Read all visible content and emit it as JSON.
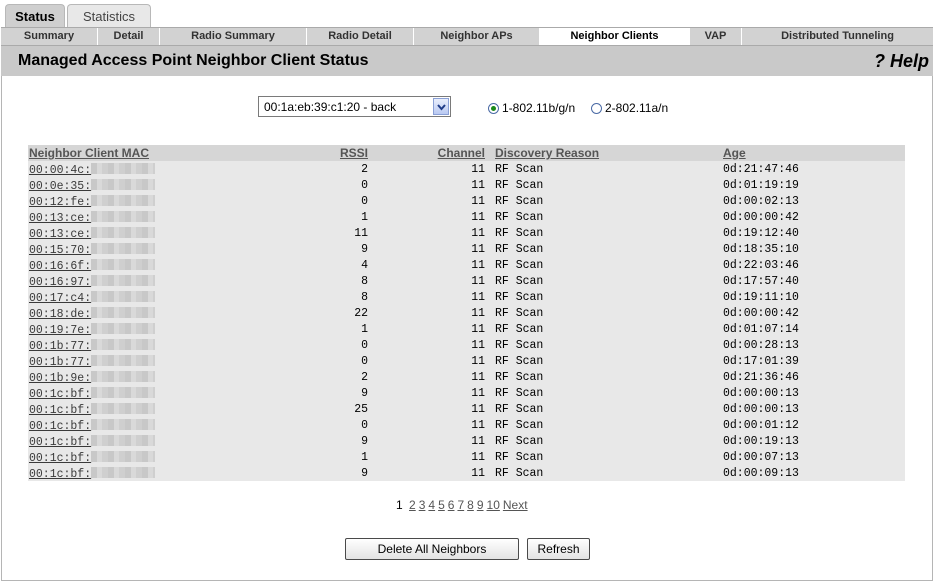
{
  "top_tabs": [
    {
      "label": "Status",
      "active": true
    },
    {
      "label": "Statistics",
      "active": false
    }
  ],
  "sub_tabs": [
    {
      "label": "Summary"
    },
    {
      "label": "Detail"
    },
    {
      "label": "Radio Summary"
    },
    {
      "label": "Radio Detail"
    },
    {
      "label": "Neighbor APs"
    },
    {
      "label": "Neighbor Clients",
      "active": true
    },
    {
      "label": "VAP"
    },
    {
      "label": "Distributed Tunneling"
    }
  ],
  "page": {
    "title": "Managed Access Point Neighbor Client Status",
    "help": "? Help"
  },
  "ap_select": {
    "value": "00:1a:eb:39:c1:20 - back"
  },
  "radios": [
    {
      "label": "1-802.11b/g/n",
      "checked": true
    },
    {
      "label": "2-802.11a/n",
      "checked": false
    }
  ],
  "table": {
    "headers": {
      "mac": "Neighbor Client MAC",
      "rssi": "RSSI",
      "channel": "Channel",
      "reason": "Discovery Reason",
      "age": "Age"
    },
    "rows": [
      {
        "mac": "00:00:4c:",
        "rssi": "2",
        "channel": "11",
        "reason": "RF Scan",
        "age": "0d:21:47:46"
      },
      {
        "mac": "00:0e:35:",
        "rssi": "0",
        "channel": "11",
        "reason": "RF Scan",
        "age": "0d:01:19:19"
      },
      {
        "mac": "00:12:fe:",
        "rssi": "0",
        "channel": "11",
        "reason": "RF Scan",
        "age": "0d:00:02:13"
      },
      {
        "mac": "00:13:ce:",
        "rssi": "1",
        "channel": "11",
        "reason": "RF Scan",
        "age": "0d:00:00:42"
      },
      {
        "mac": "00:13:ce:",
        "rssi": "11",
        "channel": "11",
        "reason": "RF Scan",
        "age": "0d:19:12:40"
      },
      {
        "mac": "00:15:70:",
        "rssi": "9",
        "channel": "11",
        "reason": "RF Scan",
        "age": "0d:18:35:10"
      },
      {
        "mac": "00:16:6f:",
        "rssi": "4",
        "channel": "11",
        "reason": "RF Scan",
        "age": "0d:22:03:46"
      },
      {
        "mac": "00:16:97:",
        "rssi": "8",
        "channel": "11",
        "reason": "RF Scan",
        "age": "0d:17:57:40"
      },
      {
        "mac": "00:17:c4:",
        "rssi": "8",
        "channel": "11",
        "reason": "RF Scan",
        "age": "0d:19:11:10"
      },
      {
        "mac": "00:18:de:",
        "rssi": "22",
        "channel": "11",
        "reason": "RF Scan",
        "age": "0d:00:00:42"
      },
      {
        "mac": "00:19:7e:",
        "rssi": "1",
        "channel": "11",
        "reason": "RF Scan",
        "age": "0d:01:07:14"
      },
      {
        "mac": "00:1b:77:",
        "rssi": "0",
        "channel": "11",
        "reason": "RF Scan",
        "age": "0d:00:28:13"
      },
      {
        "mac": "00:1b:77:",
        "rssi": "0",
        "channel": "11",
        "reason": "RF Scan",
        "age": "0d:17:01:39"
      },
      {
        "mac": "00:1b:9e:",
        "rssi": "2",
        "channel": "11",
        "reason": "RF Scan",
        "age": "0d:21:36:46"
      },
      {
        "mac": "00:1c:bf:",
        "rssi": "9",
        "channel": "11",
        "reason": "RF Scan",
        "age": "0d:00:00:13"
      },
      {
        "mac": "00:1c:bf:",
        "rssi": "25",
        "channel": "11",
        "reason": "RF Scan",
        "age": "0d:00:00:13"
      },
      {
        "mac": "00:1c:bf:",
        "rssi": "0",
        "channel": "11",
        "reason": "RF Scan",
        "age": "0d:00:01:12"
      },
      {
        "mac": "00:1c:bf:",
        "rssi": "9",
        "channel": "11",
        "reason": "RF Scan",
        "age": "0d:00:19:13"
      },
      {
        "mac": "00:1c:bf:",
        "rssi": "1",
        "channel": "11",
        "reason": "RF Scan",
        "age": "0d:00:07:13"
      },
      {
        "mac": "00:1c:bf:",
        "rssi": "9",
        "channel": "11",
        "reason": "RF Scan",
        "age": "0d:00:09:13"
      }
    ]
  },
  "pagination": {
    "current": "1",
    "pages": [
      "2",
      "3",
      "4",
      "5",
      "6",
      "7",
      "8",
      "9",
      "10"
    ],
    "next": "Next"
  },
  "buttons": {
    "delete_all": "Delete All Neighbors",
    "refresh": "Refresh"
  }
}
